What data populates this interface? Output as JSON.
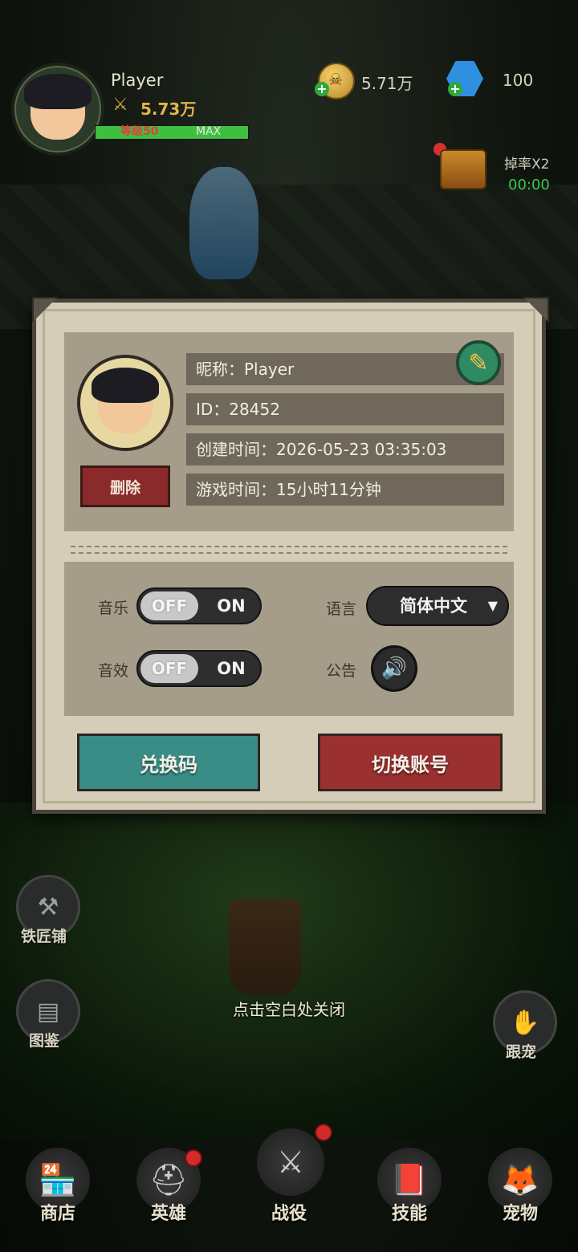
{
  "hud": {
    "player_name": "Player",
    "power": "5.73万",
    "level_text": "等级50",
    "level_max": "MAX",
    "level_progress": 1.0,
    "coins": "5.71万",
    "gems": "100",
    "drop_rate_label": "掉率X2",
    "drop_rate_timer": "00:00"
  },
  "profile": {
    "nickname_row": "昵称：Player",
    "id_row": "ID：28452",
    "created_row": "创建时间：2026-05-23 03:35:03",
    "playtime_row": "游戏时间：15小时11分钟",
    "delete_label": "删除"
  },
  "settings": {
    "music_label": "音乐",
    "sfx_label": "音效",
    "language_label": "语言",
    "notice_label": "公告",
    "off_label": "OFF",
    "on_label": "ON",
    "language_value": "简体中文"
  },
  "actions": {
    "redeem_label": "兑换码",
    "switch_account_label": "切换账号"
  },
  "side": {
    "blacksmith": "铁匠铺",
    "codex": "图鉴",
    "follow_pet": "跟宠"
  },
  "hint": "点击空白处关闭",
  "nav": {
    "shop": "商店",
    "heroes": "英雄",
    "battle": "战役",
    "skills": "技能",
    "pets": "宠物"
  },
  "colors": {
    "panel": "#d5cdb7",
    "teal_button": "#3a8c86",
    "red_button": "#9a3030",
    "level_text": "#e43c3c",
    "timer_green": "#3ec54d"
  }
}
